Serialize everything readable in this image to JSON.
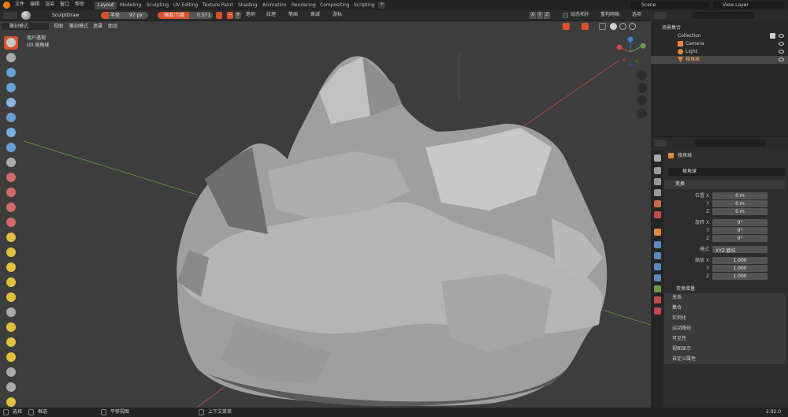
{
  "menu": {
    "items": [
      "文件",
      "编辑",
      "渲染",
      "窗口",
      "帮助"
    ]
  },
  "workspaces": {
    "tabs": [
      "Layout",
      "Modeling",
      "Sculpting",
      "UV Editing",
      "Texture Paint",
      "Shading",
      "Animation",
      "Rendering",
      "Compositing",
      "Scripting"
    ],
    "active_index": 0
  },
  "scene": {
    "name": "Scene",
    "view_layer": "View Layer"
  },
  "tool_header": {
    "brush_name": "SculptDraw",
    "radius_label": "半径",
    "radius_value": "97 px",
    "strength_label": "强度/力度",
    "strength_value": "0.571",
    "minus": "−",
    "plus": "+",
    "dropdowns": [
      "笔刷",
      "纹理",
      "笔画",
      "衰减",
      "游标"
    ],
    "axis": [
      "X",
      "Y",
      "Z"
    ],
    "dyntopo_label": "动态拓扑",
    "remesh_label": "重构网格",
    "options_label": "选项"
  },
  "viewport_header": {
    "mode": "雕刻模式",
    "menus": [
      "视图",
      "雕刻模式",
      "遮罩",
      "面组"
    ]
  },
  "viewport": {
    "overlay_title": "用户透视",
    "overlay_object": "(0) 棱角球"
  },
  "outliner": {
    "root": "场景集合",
    "collection": "Collection",
    "items": [
      {
        "name": "Camera",
        "icon": "camera-icon"
      },
      {
        "name": "Light",
        "icon": "light-icon"
      },
      {
        "name": "棱角球",
        "icon": "mesh-icon",
        "selected": true
      }
    ]
  },
  "properties": {
    "object_name_crumb": "棱角球",
    "object_name_field": "棱角球",
    "transform_header": "变换",
    "location_label": "位置 X",
    "rotation_label": "旋转 X",
    "scale_label": "缩放 X",
    "y_label": "Y",
    "z_label": "Z",
    "mode_label": "模式",
    "location": [
      "0 m",
      "0 m",
      "0 m"
    ],
    "rotation": [
      "0°",
      "0°",
      "0°"
    ],
    "rotation_mode": "XYZ 欧拉",
    "scale": [
      "1.000",
      "1.000",
      "1.000"
    ],
    "delta_transform": "变换增量",
    "panels": [
      "关系",
      "集合",
      "实例化",
      "运动路径",
      "可见性",
      "视图显示",
      "自定义属性"
    ]
  },
  "statusbar": {
    "select": "选择",
    "box_select": "框选",
    "pan": "平移视图",
    "context_menu": "上下文菜单",
    "version": "2.92.0"
  },
  "colors": {
    "accent_orange": "#d9512c",
    "active_blue": "#4772b3",
    "axis_red": "#c44a4e",
    "axis_green": "#6a9d45",
    "axis_blue": "#3f7fd1"
  }
}
